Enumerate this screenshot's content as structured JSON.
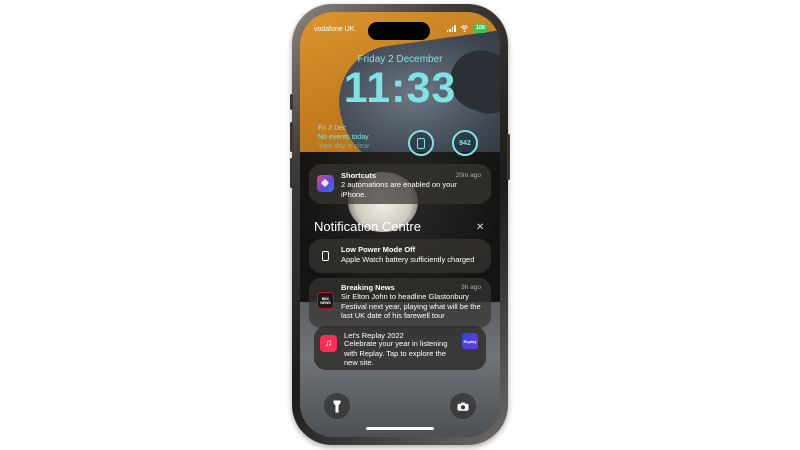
{
  "status_bar": {
    "carrier": "vodafone UK",
    "battery": "100"
  },
  "lock": {
    "date": "Friday 2 December",
    "time": "11:33"
  },
  "widgets": {
    "calendar_date": "Fri 2 Dec",
    "calendar_events": "No events today",
    "calendar_sub": "Your day is clear",
    "steps": "942"
  },
  "shortcuts_notification": {
    "app": "Shortcuts",
    "time": "20m ago",
    "body": "2 automations are enabled on your iPhone.",
    "icon": "shortcuts-icon"
  },
  "notification_centre": {
    "title": "Notification Centre",
    "close_icon": "close-icon"
  },
  "notifications": [
    {
      "app": "Low Power Mode Off",
      "time": "",
      "body": "Apple Watch battery sufficiently charged",
      "icon": "apple-watch-icon"
    },
    {
      "app": "Breaking News",
      "time": "3h ago",
      "body": "Sir Elton John to headline Glastonbury Festival next year, playing what will be the last UK date of his farewell tour",
      "icon": "bbc-news-icon",
      "icon_text": "BBC NEWS"
    },
    {
      "app": "Let's Replay 2022",
      "time": "",
      "body": "Celebrate your year in listening with Replay. Tap to explore the new site.",
      "icon": "music-icon",
      "thumb_text": "Replay"
    }
  ],
  "bottom": {
    "flashlight_icon": "flashlight-icon",
    "camera_icon": "camera-icon"
  },
  "colors": {
    "lockscreen_accent": "#7fe3e6",
    "battery": "#3cc25a",
    "music_icon": "#fa2d55",
    "shortcuts_icon": "#5b4bdc"
  }
}
